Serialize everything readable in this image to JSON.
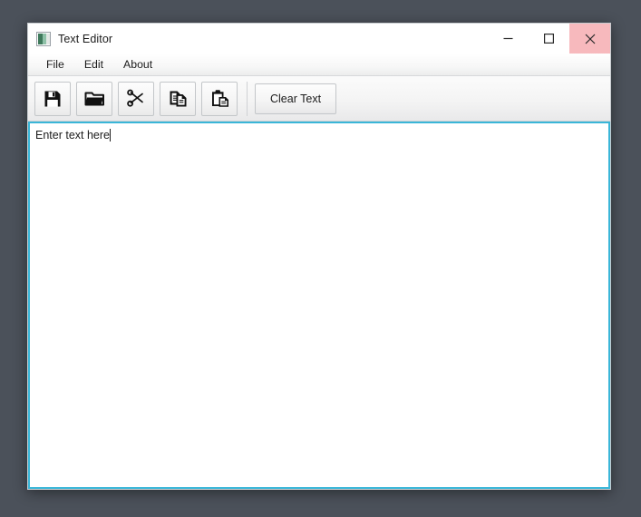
{
  "desktop": {
    "background_color": "#4b515a"
  },
  "window": {
    "title": "Text Editor",
    "icon": "app-document-icon",
    "frame_color": "#c8ccd0",
    "controls": {
      "minimize_label": "—",
      "minimize_icon": "minimize-icon",
      "maximize_label": "□",
      "maximize_icon": "maximize-icon",
      "close_label": "✕",
      "close_icon": "close-icon",
      "close_hover_color": "#f7b9bd"
    }
  },
  "menu": {
    "items": [
      {
        "label": "File"
      },
      {
        "label": "Edit"
      },
      {
        "label": "About"
      }
    ]
  },
  "toolbar": {
    "buttons": [
      {
        "name": "save-button",
        "icon": "save-floppy-icon",
        "tooltip": "Save"
      },
      {
        "name": "open-button",
        "icon": "folder-open-icon",
        "tooltip": "Open"
      },
      {
        "name": "cut-button",
        "icon": "scissors-icon",
        "tooltip": "Cut"
      },
      {
        "name": "copy-button",
        "icon": "copy-documents-icon",
        "tooltip": "Copy"
      },
      {
        "name": "paste-button",
        "icon": "clipboard-paste-icon",
        "tooltip": "Paste"
      }
    ],
    "clear_text_label": "Clear Text"
  },
  "editor": {
    "content": "Enter text here",
    "placeholder": "Enter text here",
    "focus_border_color": "#3ab6d8",
    "caret_visible": true
  }
}
